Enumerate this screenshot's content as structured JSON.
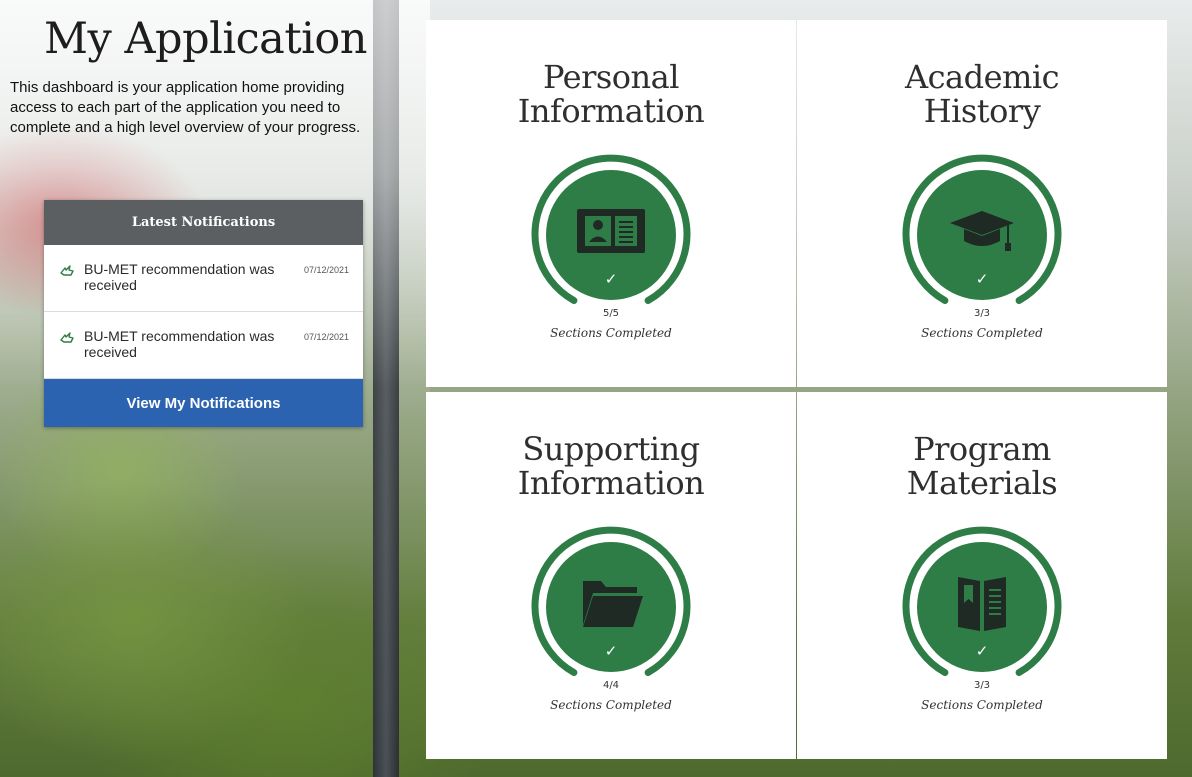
{
  "header": {
    "title": "My Application",
    "intro": "This dashboard is your application home providing access to each part of the application you need to complete and a high level overview of your progress."
  },
  "notifications": {
    "heading": "Latest Notifications",
    "items": [
      {
        "text": "BU-MET recommendation was received",
        "date": "07/12/2021",
        "icon": "hand-icon"
      },
      {
        "text": "BU-MET recommendation was received",
        "date": "07/12/2021",
        "icon": "hand-icon"
      }
    ],
    "button_label": "View My Notifications"
  },
  "sections": [
    {
      "title_line1": "Personal",
      "title_line2": "Information",
      "icon": "id-card-icon",
      "completed": 5,
      "total": 5,
      "count_label": "5/5",
      "status_label": "Sections Completed",
      "check": "✓"
    },
    {
      "title_line1": "Academic",
      "title_line2": "History",
      "icon": "graduation-cap-icon",
      "completed": 3,
      "total": 3,
      "count_label": "3/3",
      "status_label": "Sections Completed",
      "check": "✓"
    },
    {
      "title_line1": "Supporting",
      "title_line2": "Information",
      "icon": "folder-icon",
      "completed": 4,
      "total": 4,
      "count_label": "4/4",
      "status_label": "Sections Completed",
      "check": "✓"
    },
    {
      "title_line1": "Program",
      "title_line2": "Materials",
      "icon": "book-icon",
      "completed": 3,
      "total": 3,
      "count_label": "3/3",
      "status_label": "Sections Completed",
      "check": "✓"
    }
  ],
  "colors": {
    "accent_green": "#2e7d46",
    "header_gray": "#5b5f62",
    "button_blue": "#2b63b0",
    "icon_dark": "#1f2a24"
  }
}
